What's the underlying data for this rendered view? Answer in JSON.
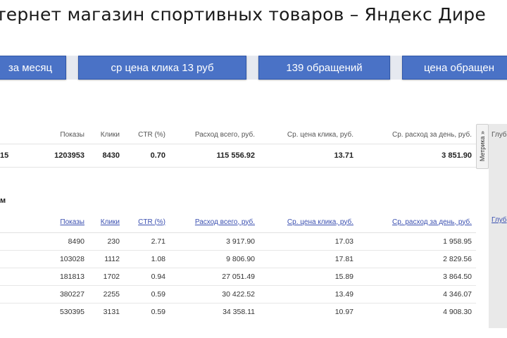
{
  "title": "тернет магазин спортивных товаров – Яндекс Дире",
  "banners": [
    "за месяц",
    "ср цена клика 13 руб",
    "139 обращений",
    "цена обращен"
  ],
  "colors": {
    "banner": "#4a72c6",
    "link": "#3a4fb0"
  },
  "summary": {
    "headers": [
      "Показы",
      "Клики",
      "CTR (%)",
      "Расход всего, руб.",
      "Ср. цена клика, руб.",
      "Ср. расход за день, руб."
    ],
    "row_label": "15",
    "row": [
      "1203953",
      "8430",
      "0.70",
      "115 556.92",
      "13.71",
      "3 851.90"
    ]
  },
  "side": {
    "tab_label": "Метрика »",
    "col_header": "Глуб"
  },
  "section_label": "м",
  "details": {
    "headers": [
      "Показы",
      "Клики",
      "CTR (%)",
      "Расход всего, руб.",
      "Ср. цена клика, руб.",
      "Ср. расход за день, руб."
    ],
    "rows": [
      [
        "8490",
        "230",
        "2.71",
        "3 917.90",
        "17.03",
        "1 958.95"
      ],
      [
        "103028",
        "1112",
        "1.08",
        "9 806.90",
        "17.81",
        "2 829.56"
      ],
      [
        "181813",
        "1702",
        "0.94",
        "27 051.49",
        "15.89",
        "3 864.50"
      ],
      [
        "380227",
        "2255",
        "0.59",
        "30 422.52",
        "13.49",
        "4 346.07"
      ],
      [
        "530395",
        "3131",
        "0.59",
        "34 358.11",
        "10.97",
        "4 908.30"
      ]
    ]
  }
}
